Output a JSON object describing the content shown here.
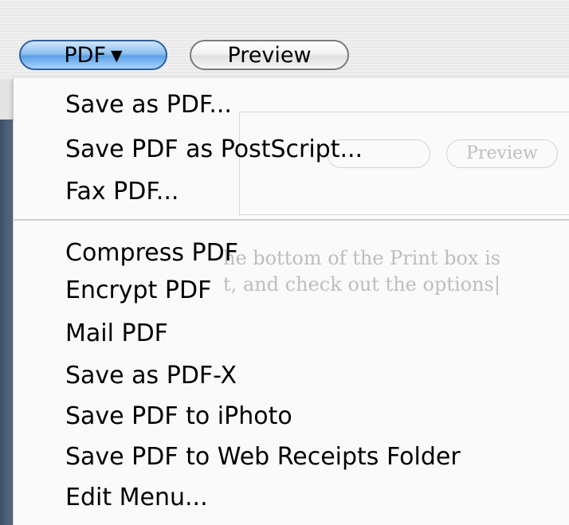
{
  "toolbar": {
    "pdf_button_label": "PDF",
    "pdf_button_arrow": "▼",
    "preview_button_label": "Preview"
  },
  "menu": {
    "group1": [
      {
        "label": "Save as PDF..."
      },
      {
        "label": "Save PDF as PostScript..."
      },
      {
        "label": "Fax PDF..."
      }
    ],
    "group2": [
      {
        "label": "Compress PDF"
      },
      {
        "label": "Encrypt PDF"
      },
      {
        "label": "Mail PDF"
      },
      {
        "label": "Save as PDF-X"
      },
      {
        "label": "Save PDF to iPhoto"
      },
      {
        "label": "Save PDF to Web Receipts Folder"
      },
      {
        "label": "Edit Menu..."
      }
    ]
  },
  "background": {
    "preview_label": "Preview",
    "line1": "he bottom of the Print box is",
    "line2": "t, and check out the options|"
  },
  "colors": {
    "accent": "#5c9fe6",
    "menu_background": "#fafafa",
    "sidebar": "#3b4f66"
  }
}
